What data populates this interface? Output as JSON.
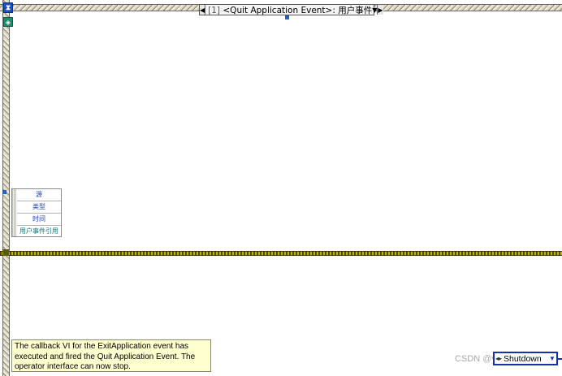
{
  "case_selector": {
    "index": "[1]",
    "event": "<Quit Application Event>: 用户事件"
  },
  "event_data_node": {
    "items": [
      "源",
      "类型",
      "时间",
      "用户事件引用"
    ]
  },
  "comment": {
    "text": "The callback VI for the ExitApplication event has executed and fired the Quit Application Event. The operator interface can now stop."
  },
  "shutdown_constant": {
    "value": "Shutdown"
  },
  "watermark": {
    "text": "CSDN @yundou2x"
  },
  "colors": {
    "wire": "#c7b400",
    "terminal": "#1f5fd6",
    "comment_bg": "#ffffd0"
  }
}
